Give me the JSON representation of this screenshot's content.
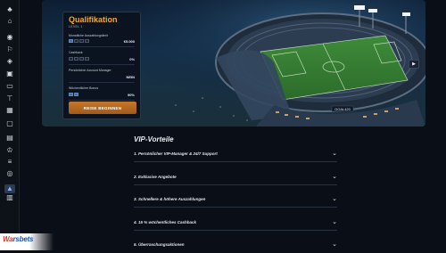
{
  "sidebar": {
    "icons": [
      "casino-icon",
      "home-icon",
      "promo-icon",
      "sports-icon",
      "football-icon",
      "esports-icon",
      "live-icon",
      "tshirt-icon",
      "gift-icon",
      "chat-icon",
      "shop-icon",
      "trophy-icon",
      "leaderboard-icon",
      "bonus-icon",
      "settings-icon",
      "calendar-icon",
      "vip-icon"
    ]
  },
  "logo": {
    "part1": "Wa",
    "part2": "rsbets",
    "full": "Warsbets"
  },
  "qualification": {
    "title": "Qualifikation",
    "level": "LEVEL 1",
    "rows": [
      {
        "label": "Monatliche Auszahlungslimit",
        "value": "€5.000"
      },
      {
        "label": "Cashback",
        "value": "0%"
      },
      {
        "label": "Persönlicher Account Manager",
        "value": "NEIN"
      },
      {
        "label": "Wöchentlicher Bonus",
        "value": "90%"
      }
    ],
    "button": "REISE BEGINNEN"
  },
  "hero": {
    "stadium_sign": "GOAL420",
    "next_label": "▶"
  },
  "vip": {
    "title": "VIP-Vorteile",
    "items": [
      "1. Persönlicher VIP-Manager & 24/7 Support",
      "2. Exklusive Angebote",
      "3. Schnellere & höhere Auszahlungen",
      "4. 15 % wöchentliches Cashback",
      "5. Überraschungsaktionen"
    ],
    "chevron": "⌄"
  }
}
